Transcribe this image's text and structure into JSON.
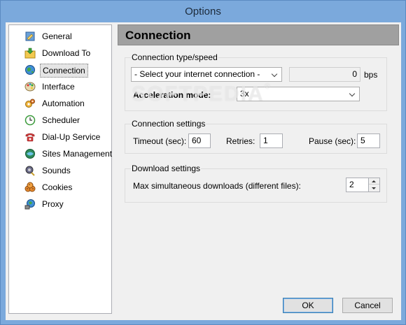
{
  "window": {
    "title": "Options"
  },
  "sidebar": {
    "items": [
      {
        "label": "General",
        "icon": "general-icon"
      },
      {
        "label": "Download To",
        "icon": "download-folder-icon"
      },
      {
        "label": "Connection",
        "icon": "globe-icon",
        "selected": true
      },
      {
        "label": "Interface",
        "icon": "palette-icon"
      },
      {
        "label": "Automation",
        "icon": "gear-icon"
      },
      {
        "label": "Scheduler",
        "icon": "clock-icon"
      },
      {
        "label": "Dial-Up Service",
        "icon": "phone-icon"
      },
      {
        "label": "Sites Management",
        "icon": "globe-sites-icon"
      },
      {
        "label": "Sounds",
        "icon": "sounds-icon"
      },
      {
        "label": "Cookies",
        "icon": "cookies-icon"
      },
      {
        "label": "Proxy",
        "icon": "proxy-icon"
      }
    ]
  },
  "panel": {
    "title": "Connection"
  },
  "connection_type": {
    "group_label": "Connection type/speed",
    "select_value": "- Select your internet connection -",
    "speed_value": "0",
    "speed_unit": "bps",
    "acceleration_label": "Acceleration mode:",
    "acceleration_value": "3x"
  },
  "connection_settings": {
    "group_label": "Connection settings",
    "timeout_label": "Timeout (sec):",
    "timeout_value": "60",
    "retries_label": "Retries:",
    "retries_value": "1",
    "pause_label": "Pause (sec):",
    "pause_value": "5"
  },
  "download_settings": {
    "group_label": "Download settings",
    "max_label": "Max simultaneous downloads (different files):",
    "max_value": "2"
  },
  "buttons": {
    "ok": "OK",
    "cancel": "Cancel"
  },
  "watermark": {
    "text": "SOFTPEDIA",
    "mark": "®"
  }
}
